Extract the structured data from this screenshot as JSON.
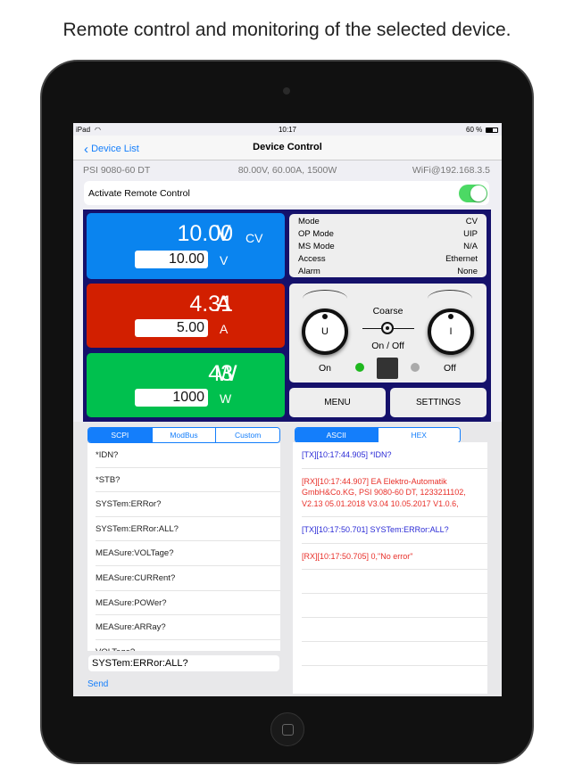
{
  "caption": "Remote control and monitoring of the selected device.",
  "status_bar": {
    "device": "iPad",
    "time": "10:17",
    "battery": "60 %"
  },
  "nav": {
    "back_label": "Device List",
    "title": "Device Control"
  },
  "device_info": {
    "model": "PSI 9080-60 DT",
    "ratings": "80.00V, 60.00A, 1500W",
    "connection": "WiFi@192.168.3.5"
  },
  "remote": {
    "label": "Activate Remote Control",
    "enabled": true
  },
  "voltage": {
    "actual": "10.00",
    "unit": "V",
    "set": "10.00",
    "mode": "CV",
    "color": "#0a84ef"
  },
  "current": {
    "actual": "4.31",
    "unit": "A",
    "set": "5.00",
    "color": "#d21f00"
  },
  "power": {
    "actual": "43",
    "unit": "W",
    "set": "1000",
    "color": "#00c04e"
  },
  "status": [
    {
      "k": "Mode",
      "v": "CV"
    },
    {
      "k": "OP Mode",
      "v": "UIP"
    },
    {
      "k": "MS Mode",
      "v": "N/A"
    },
    {
      "k": "Access",
      "v": "Ethernet"
    },
    {
      "k": "Alarm",
      "v": "None"
    }
  ],
  "knobs": {
    "u": "U",
    "i": "I",
    "coarse": "Coarse",
    "onoff": "On / Off",
    "on": "On",
    "off": "Off"
  },
  "buttons": {
    "menu": "MENU",
    "settings": "SETTINGS"
  },
  "cmd_tabs": [
    "SCPI",
    "ModBus",
    "Custom"
  ],
  "commands": [
    "*IDN?",
    "*STB?",
    "SYSTem:ERRor?",
    "SYSTem:ERRor:ALL?",
    "MEASure:VOLTage?",
    "MEASure:CURRent?",
    "MEASure:POWer?",
    "MEASure:ARRay?",
    "VOLTage?"
  ],
  "command_input": "SYSTem:ERRor:ALL?",
  "send_label": "Send",
  "log_tabs": [
    "ASCII",
    "HEX"
  ],
  "log": [
    {
      "type": "tx",
      "text": "[TX][10:17:44.905] *IDN?"
    },
    {
      "type": "rx",
      "text": "[RX][10:17:44.907] EA Elektro-Automatik GmbH&Co.KG, PSI 9080-60 DT, 1233211102, V2.13 05.01.2018 V3.04 10.05.2017 V1.0.6,"
    },
    {
      "type": "tx",
      "text": "[TX][10:17:50.701] SYSTem:ERRor:ALL?"
    },
    {
      "type": "rx",
      "text": "[RX][10:17:50.705] 0,\"No error\""
    }
  ]
}
